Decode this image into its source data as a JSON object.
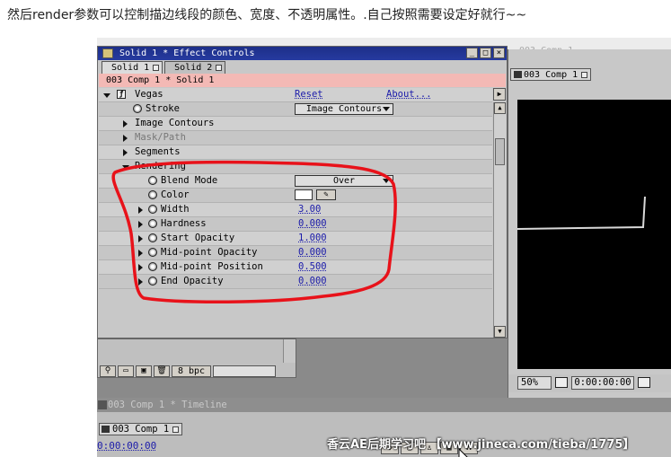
{
  "caption": "然后render参数可以控制描边线段的颜色、宽度、不透明属性。.自己按照需要设定好就行~~",
  "background_title": "003 Comp 1",
  "effect_controls": {
    "title": "Solid 1 * Effect Controls",
    "window_buttons": [
      "_",
      "□",
      "×"
    ],
    "tabs": [
      {
        "label": "Solid 1"
      },
      {
        "label": "Solid 2"
      }
    ],
    "layer_path": "003 Comp 1 * Solid 1",
    "effect_name": "Vegas",
    "reset": "Reset",
    "about": "About...",
    "stroke_label": "Stroke",
    "stroke_value": "Image Contours",
    "groups": {
      "image_contours": "Image Contours",
      "mask_path": "Mask/Path",
      "segments": "Segments",
      "rendering": "Rendering"
    },
    "params": {
      "blend_mode": {
        "label": "Blend Mode",
        "value": "Over"
      },
      "color": {
        "label": "Color",
        "value": "#ffffff"
      },
      "width": {
        "label": "Width",
        "value": "3.00"
      },
      "hardness": {
        "label": "Hardness",
        "value": "0.000"
      },
      "start_opacity": {
        "label": "Start Opacity",
        "value": "1.000"
      },
      "mid_point_opacity": {
        "label": "Mid-point Opacity",
        "value": "0.000"
      },
      "mid_point_position": {
        "label": "Mid-point Position",
        "value": "0.500"
      },
      "end_opacity": {
        "label": "End Opacity",
        "value": "0.000"
      }
    }
  },
  "project": {
    "bpc": "8 bpc"
  },
  "comp_viewer": {
    "tab": "003 Comp 1",
    "zoom": "50%",
    "timecode": "0:00:00:00"
  },
  "timeline": {
    "title": "003 Comp 1 * Timeline",
    "tab": "003 Comp 1",
    "time": "0:00:00:00"
  },
  "watermark": "香云AE后期学习吧 【www.jineca.com/tieba/1775】",
  "colors": {
    "annotation": "#e8121a",
    "title_bar": "#1d2f88",
    "link_blue": "#1b1baa",
    "layer_bar": "#f3b9b5"
  }
}
